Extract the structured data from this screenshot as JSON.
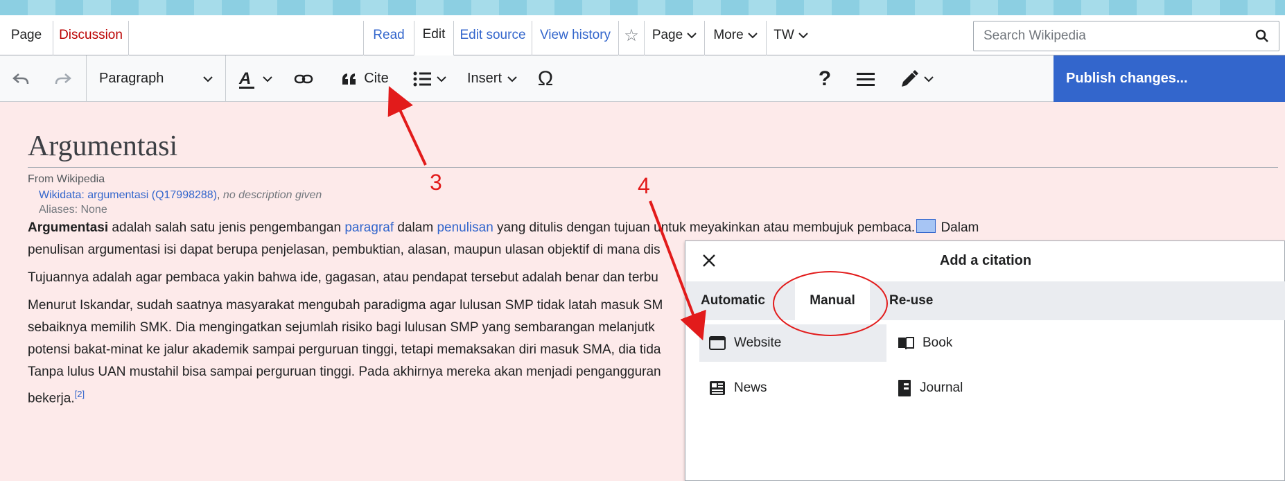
{
  "tabs": {
    "page": "Page",
    "discussion": "Discussion",
    "read": "Read",
    "edit": "Edit",
    "edit_source": "Edit source",
    "view_history": "View history",
    "page_menu": "Page",
    "more": "More",
    "tw": "TW"
  },
  "search": {
    "placeholder": "Search Wikipedia"
  },
  "toolbar": {
    "paragraph": "Paragraph",
    "cite": "Cite",
    "insert": "Insert",
    "special_char": "Ω",
    "help": "?",
    "publish": "Publish changes..."
  },
  "article": {
    "title": "Argumentasi",
    "from": "From Wikipedia",
    "wikidata_link": "Wikidata: argumentasi (Q17998288)",
    "wikidata_sep": ", ",
    "wikidata_desc": "no description given",
    "aliases": "Aliases: None",
    "p1a_bold": "Argumentasi",
    "p1a_t1": " adalah salah satu jenis pengembangan ",
    "p1a_link1": "paragraf",
    "p1a_t2": " dalam ",
    "p1a_link2": "penulisan",
    "p1a_t3": " yang ditulis dengan tujuan untuk meyakinkan atau membujuk pembaca.",
    "p1a_t4": " Dalam",
    "p1b": "penulisan argumentasi isi dapat berupa penjelasan, pembuktian, alasan, maupun ulasan objektif di mana dis",
    "p2": "Tujuannya adalah agar pembaca yakin bahwa ide, gagasan, atau pendapat tersebut adalah benar dan terbu",
    "p3a": "Menurut Iskandar, sudah saatnya masyarakat mengubah paradigma agar lulusan SMP tidak latah masuk SM",
    "p3b": "sebaiknya memilih SMK. Dia mengingatkan sejumlah risiko bagi lulusan SMP yang sembarangan melanjutk",
    "p3c": "potensi bakat-minat ke jalur akademik sampai perguruan tinggi, tetapi memaksakan diri masuk SMA, dia tida",
    "p3d": "Tanpa lulus UAN mustahil bisa sampai perguruan tinggi. Pada akhirnya mereka akan menjadi pengangguran",
    "p3e": "bekerja.",
    "p3e_ref": "[2]"
  },
  "dialog": {
    "title": "Add a citation",
    "tabs": {
      "automatic": "Automatic",
      "manual": "Manual",
      "reuse": "Re-use"
    },
    "options": {
      "website": "Website",
      "book": "Book",
      "news": "News",
      "journal": "Journal"
    }
  },
  "annotations": {
    "label3": "3",
    "label4": "4",
    "color": "#e21b1b"
  },
  "colors": {
    "accent": "#3366cc",
    "content_bg": "#fdeaea",
    "annotation": "#e21b1b"
  }
}
